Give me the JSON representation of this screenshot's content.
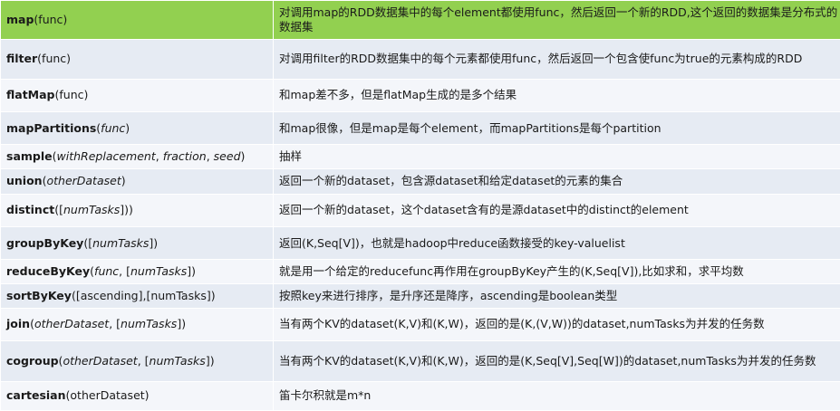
{
  "rows": [
    {
      "name": "map",
      "args": [
        {
          "t": "(func)",
          "i": false
        }
      ],
      "desc": "对调用map的RDD数据集中的每个element都使用func，然后返回一个新的RDD,这个返回的数据集是分布式的数据集",
      "h": 40
    },
    {
      "name": "filter",
      "args": [
        {
          "t": "(func)",
          "i": false
        }
      ],
      "desc": "对调用filter的RDD数据集中的每个元素都使用func，然后返回一个包含使func为true的元素构成的RDD",
      "h": 41
    },
    {
      "name": "flatMap",
      "args": [
        {
          "t": "(func)",
          "i": false
        }
      ],
      "desc": "和map差不多，但是flatMap生成的是多个结果",
      "h": 34
    },
    {
      "name": "mapPartitions",
      "args": [
        {
          "t": "(",
          "i": false
        },
        {
          "t": "func",
          "i": true
        },
        {
          "t": ")",
          "i": false
        }
      ],
      "desc": "和map很像，但是map是每个element，而mapPartitions是每个partition",
      "h": 34
    },
    {
      "name": "sample",
      "args": [
        {
          "t": "(",
          "i": false
        },
        {
          "t": "withReplacement",
          "i": true
        },
        {
          "t": ", ",
          "i": false
        },
        {
          "t": "fraction",
          "i": true
        },
        {
          "t": ", ",
          "i": false
        },
        {
          "t": "seed",
          "i": true
        },
        {
          "t": ")",
          "i": false
        }
      ],
      "desc": "抽样",
      "h": 25
    },
    {
      "name": "union",
      "args": [
        {
          "t": "(",
          "i": false
        },
        {
          "t": "otherDataset",
          "i": true
        },
        {
          "t": ")",
          "i": false
        }
      ],
      "desc": "返回一个新的dataset，包含源dataset和给定dataset的元素的集合",
      "h": 26
    },
    {
      "name": "distinct",
      "args": [
        {
          "t": "([",
          "i": false
        },
        {
          "t": "numTasks",
          "i": true
        },
        {
          "t": "]))",
          "i": false
        }
      ],
      "desc": "返回一个新的dataset，这个dataset含有的是源dataset中的distinct的element",
      "h": 34
    },
    {
      "name": "groupByKey",
      "args": [
        {
          "t": "([",
          "i": false
        },
        {
          "t": "numTasks",
          "i": true
        },
        {
          "t": "])",
          "i": false
        }
      ],
      "desc": "返回(K,Seq[V])，也就是hadoop中reduce函数接受的key-valuelist",
      "h": 34
    },
    {
      "name": "reduceByKey",
      "args": [
        {
          "t": "(",
          "i": false
        },
        {
          "t": "func",
          "i": true
        },
        {
          "t": ", [",
          "i": false
        },
        {
          "t": "numTasks",
          "i": true
        },
        {
          "t": "])",
          "i": false
        }
      ],
      "desc": "就是用一个给定的reducefunc再作用在groupByKey产生的(K,Seq[V]),比如求和，求平均数",
      "h": 25
    },
    {
      "name": "sortByKey",
      "args": [
        {
          "t": "([ascending],[numTasks])",
          "i": false
        }
      ],
      "desc": "按照key来进行排序，是升序还是降序，ascending是boolean类型",
      "h": 25
    },
    {
      "name": "join",
      "args": [
        {
          "t": "(",
          "i": false
        },
        {
          "t": "otherDataset",
          "i": true
        },
        {
          "t": ", [",
          "i": false
        },
        {
          "t": "numTasks",
          "i": true
        },
        {
          "t": "])",
          "i": false
        }
      ],
      "desc": "当有两个KV的dataset(K,V)和(K,W)，返回的是(K,(V,W))的dataset,numTasks为并发的任务数",
      "h": 34
    },
    {
      "name": "cogroup",
      "args": [
        {
          "t": "(",
          "i": false
        },
        {
          "t": "otherDataset",
          "i": true
        },
        {
          "t": ", [",
          "i": false
        },
        {
          "t": "numTasks",
          "i": true
        },
        {
          "t": "])",
          "i": false
        }
      ],
      "desc": "当有两个KV的dataset(K,V)和(K,W)，返回的是(K,Seq[V],Seq[W])的dataset,numTasks为并发的任务数",
      "h": 42
    },
    {
      "name": "cartesian",
      "args": [
        {
          "t": "(otherDataset)",
          "i": false
        }
      ],
      "desc": "笛卡尔积就是m*n",
      "h": 30
    }
  ]
}
